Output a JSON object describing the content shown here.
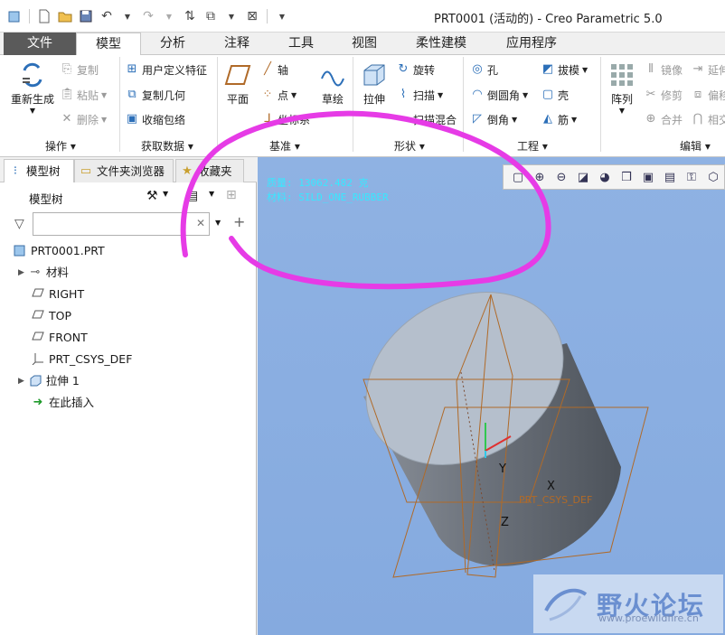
{
  "window_title": "PRT0001 (活动的) - Creo Parametric 5.0",
  "ribbon_tabs": [
    "文件",
    "模型",
    "分析",
    "注释",
    "工具",
    "视图",
    "柔性建模",
    "应用程序"
  ],
  "groups": {
    "operations": {
      "label": "操作",
      "regen": "重新生成",
      "copy": "复制",
      "paste": "粘贴",
      "delete": "删除"
    },
    "get_data": {
      "label": "获取数据",
      "udf": "用户定义特征",
      "copy_geom": "复制几何",
      "shrinkwrap": "收缩包络"
    },
    "datum": {
      "label": "基准",
      "plane": "平面",
      "axis": "轴",
      "point": "点",
      "csys": "坐标系",
      "sketch": "草绘"
    },
    "shapes": {
      "label": "形状",
      "extrude": "拉伸",
      "revolve": "旋转",
      "sweep": "扫描",
      "swept_blend": "扫描混合"
    },
    "engineering": {
      "label": "工程",
      "hole": "孔",
      "round": "倒圆角",
      "chamfer": "倒角",
      "draft": "拔模",
      "shell": "壳",
      "rib": "筋"
    },
    "editing": {
      "label": "编辑",
      "pattern": "阵列",
      "mirror": "镜像",
      "trim": "修剪",
      "merge": "合并",
      "extend": "延伸",
      "offset": "偏移",
      "intersect": "相交"
    }
  },
  "panel_tabs": [
    "模型树",
    "文件夹浏览器",
    "收藏夹"
  ],
  "tree": {
    "header": "模型树",
    "search_placeholder": "",
    "items": [
      {
        "label": "PRT0001.PRT",
        "icon": "part-icon"
      },
      {
        "label": "材料",
        "icon": "material-icon"
      },
      {
        "label": "RIGHT",
        "icon": "datum-plane-icon"
      },
      {
        "label": "TOP",
        "icon": "datum-plane-icon"
      },
      {
        "label": "FRONT",
        "icon": "datum-plane-icon"
      },
      {
        "label": "PRT_CSYS_DEF",
        "icon": "csys-icon"
      },
      {
        "label": "拉伸 1",
        "icon": "extrude-feature-icon"
      },
      {
        "label": "在此插入",
        "icon": "insert-here-icon"
      }
    ]
  },
  "viewport": {
    "info_line1": "质量: 13062.482 克",
    "info_line2": "材料: SILD_ONE_RUBBER",
    "axis_y": "Y",
    "axis_x": "X",
    "axis_z": "Z",
    "csys_label": "PRT_CSYS_DEF"
  },
  "watermark": {
    "text": "野火论坛",
    "url": "www.proewildfire.cn"
  },
  "colors": {
    "file_tab": "#5a5a5a",
    "viewport_bg": "#8fb2e3",
    "annotation": "#e63be6",
    "datum_orange": "#b06a28",
    "info_cyan": "#38e8ff"
  }
}
